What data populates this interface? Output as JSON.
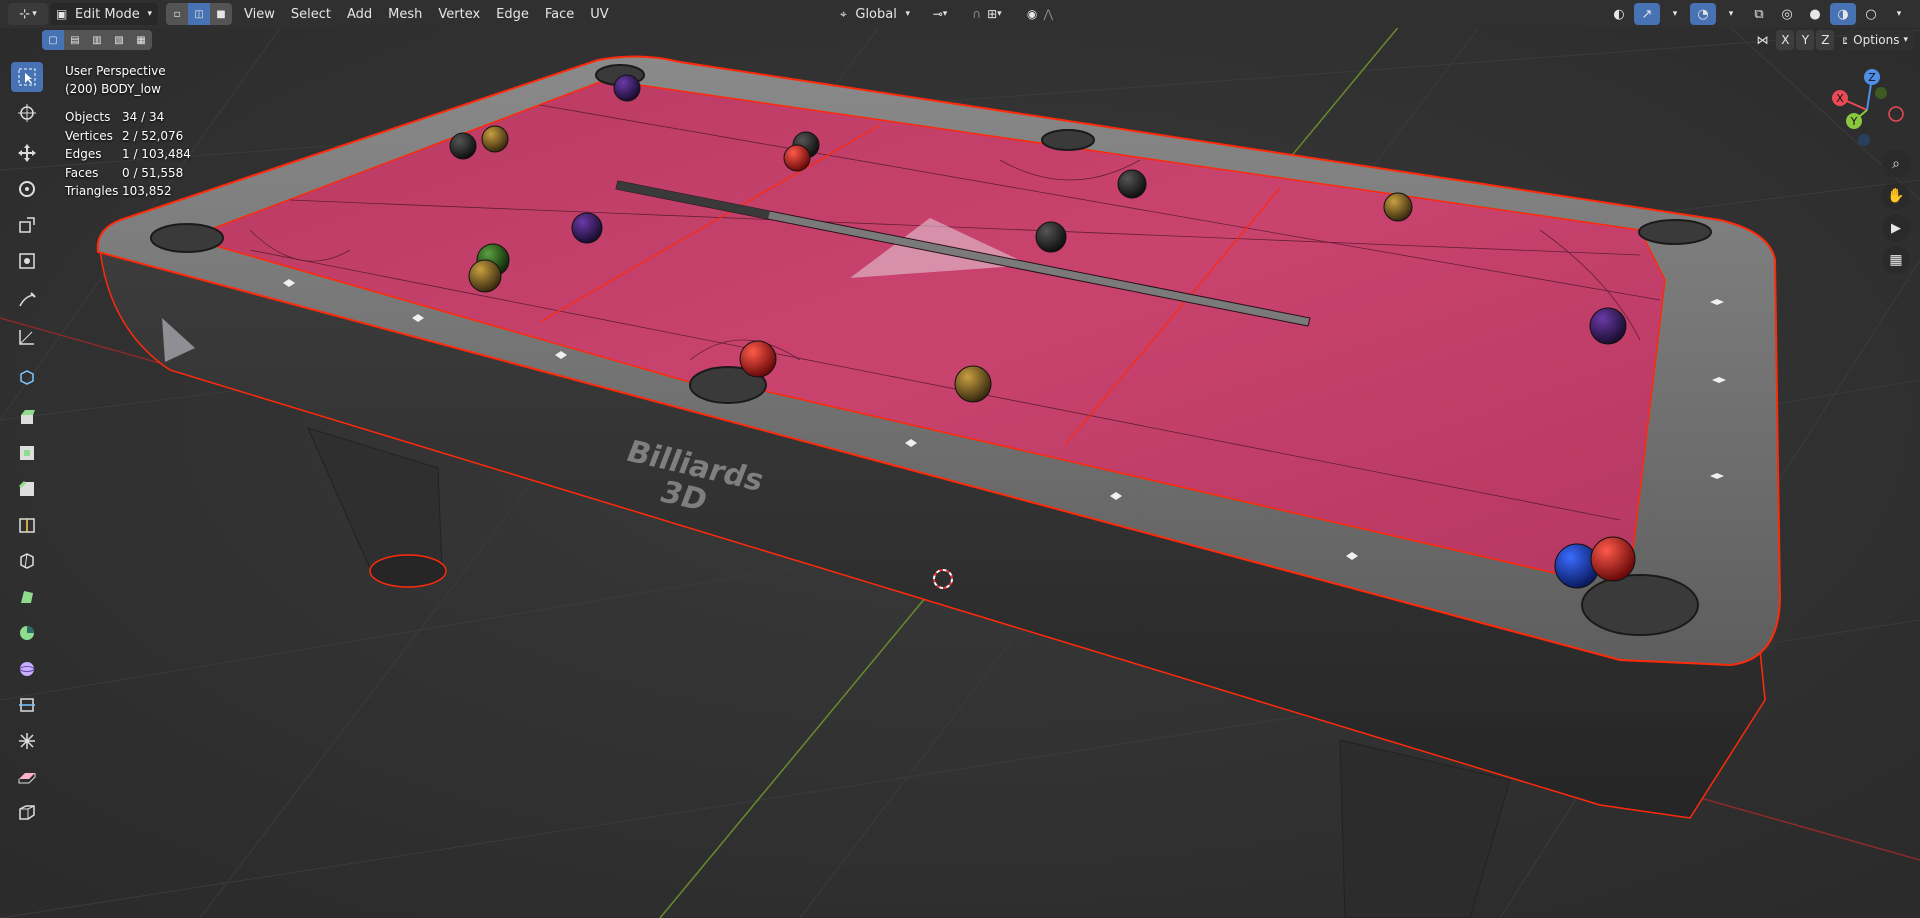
{
  "header": {
    "mode": "Edit Mode",
    "menus": [
      "View",
      "Select",
      "Add",
      "Mesh",
      "Vertex",
      "Edge",
      "Face",
      "UV"
    ],
    "transform_orientation": "Global",
    "axes": [
      "X",
      "Y",
      "Z"
    ],
    "options_label": "Options"
  },
  "overlay": {
    "view_name": "User Perspective",
    "object_name": "(200) BODY_low",
    "stats": [
      {
        "label": "Objects",
        "value": "34 / 34"
      },
      {
        "label": "Vertices",
        "value": "2 / 52,076"
      },
      {
        "label": "Edges",
        "value": "1 / 103,484"
      },
      {
        "label": "Faces",
        "value": "0 / 51,558"
      },
      {
        "label": "Triangles",
        "value": "103,852"
      }
    ]
  },
  "scene": {
    "brand_line1": "Billiards",
    "brand_line2": "3D"
  },
  "gizmo": {
    "x_label": "X",
    "y_label": "Y",
    "z_label": "Z",
    "colors": {
      "x": "#e84a56",
      "y": "#8bc63f",
      "z": "#4f8fe8"
    }
  },
  "colors": {
    "accent": "#4772b3",
    "felt": "#c9436e",
    "selection_edge": "#ff2a0a",
    "background": "#303030"
  },
  "toolbar_icons": [
    "select-box-icon",
    "cursor-icon",
    "move-icon",
    "rotate-icon",
    "scale-icon",
    "transform-icon",
    "annotate-icon",
    "measure-icon",
    "add-cube-icon",
    "extrude-icon",
    "inset-icon",
    "bevel-icon",
    "loop-cut-icon",
    "knife-icon",
    "poly-build-icon",
    "spin-icon",
    "smooth-icon",
    "edge-slide-icon",
    "shrink-fatten-icon",
    "shear-icon",
    "rip-icon"
  ]
}
